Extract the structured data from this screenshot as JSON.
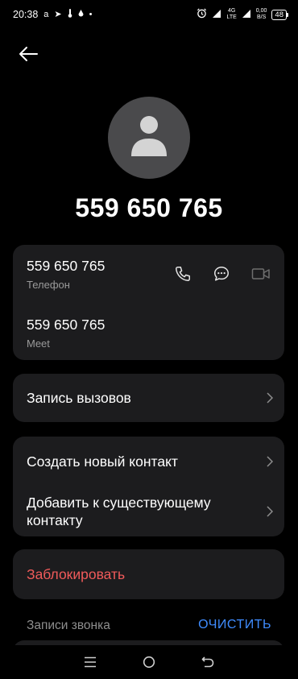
{
  "status_bar": {
    "time": "20:38",
    "left_icons": [
      "a-logo-icon",
      "telegram-icon",
      "thermometer-icon",
      "droplet-icon",
      "dot-icon"
    ],
    "left_glyphs": [
      "a",
      "➤",
      "🌡",
      "💧",
      "•"
    ],
    "network_top": "4G",
    "network_bottom": "LTE",
    "speed_top": "0,00",
    "speed_bottom": "B/S",
    "battery": "48"
  },
  "contact": {
    "number_title": "559 650 765"
  },
  "numbers": [
    {
      "value": "559 650 765",
      "label": "Телефон"
    },
    {
      "value": "559 650 765",
      "label": "Meet"
    }
  ],
  "menu": {
    "call_log": "Запись вызовов",
    "create_contact": "Создать новый контакт",
    "add_to_existing": "Добавить к существующему контакту",
    "block": "Заблокировать"
  },
  "history": {
    "section_label": "Записи звонка",
    "clear": "ОЧИСТИТЬ"
  },
  "colors": {
    "background": "#000000",
    "card": "#1c1c1e",
    "block_text": "#f05a5a",
    "accent": "#3f8cff"
  }
}
